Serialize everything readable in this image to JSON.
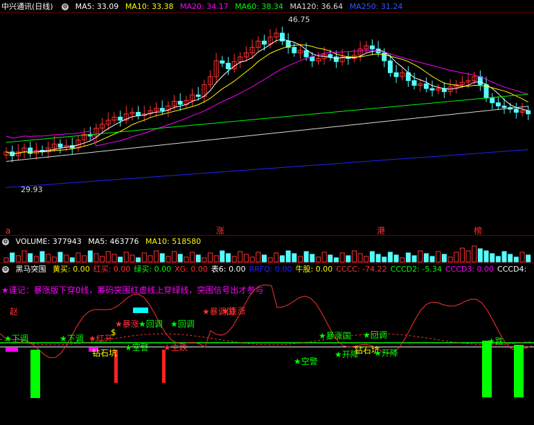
{
  "colors": {
    "up": "#ff3333",
    "down": "#54fcfc",
    "ma5": "#ffffff",
    "ma10": "#ffff00",
    "ma20": "#ff00ff",
    "ma60": "#00ff00",
    "ma120": "#dddddd",
    "ma250": "#2222ff",
    "bg": "#000000",
    "grid": "#7a0000"
  },
  "main": {
    "title": "中兴通讯(日线)",
    "ma5": "MA5: 33.09",
    "ma10": "MA10: 33.38",
    "ma20": "MA20: 34.17",
    "ma60": "MA60: 38.34",
    "ma120": "MA120: 36.64",
    "ma250": "MA250: 31.24",
    "high_label": "46.75",
    "low_label": "29.93",
    "markers": [
      "涨",
      "港",
      "榜"
    ],
    "marker_a": "a"
  },
  "volume": {
    "label": "VOLUME: 377943",
    "ma5": "MA5: 463776",
    "ma10": "MA10: 518580"
  },
  "indicator": {
    "name": "黑马突围",
    "fields": [
      {
        "text": "黄买: 0.00",
        "color": "#ffff00"
      },
      {
        "text": "红买: 0.00",
        "color": "#ff3333"
      },
      {
        "text": "绿买: 0.00",
        "color": "#00ff00"
      },
      {
        "text": "XG: 0.00",
        "color": "#ff3333"
      },
      {
        "text": "表6: 0.00",
        "color": "#ffffff"
      },
      {
        "text": "RRFQ: 0.00",
        "color": "#2222ff"
      },
      {
        "text": "牛股: 0.00",
        "color": "#ffff00"
      },
      {
        "text": "CCCC: -74.22",
        "color": "#ff3333"
      },
      {
        "text": "CCCD2: -5.34",
        "color": "#00ff00"
      },
      {
        "text": "CCCD3: 0.00",
        "color": "#ff00ff"
      },
      {
        "text": "CCCD4:",
        "color": "#ffffff"
      }
    ],
    "note": "★谨记：暴涨版下穿0线，筹码突围红虚线上穿绿线，突围信号出才参与",
    "signals": [
      {
        "text": "赵",
        "color": "#ff3333"
      },
      {
        "text": "★下调",
        "color": "#00ff00"
      },
      {
        "text": "★下调",
        "color": "#00ff00"
      },
      {
        "text": "★红开",
        "color": "#ff3333"
      },
      {
        "text": "钻石坑",
        "color": "#ffff00"
      },
      {
        "text": "★回调",
        "color": "#00ff00"
      },
      {
        "text": "★空警",
        "color": "#00ff00"
      },
      {
        "text": "★主跌",
        "color": "#ff3333"
      },
      {
        "text": "★暴涨",
        "color": "#ff3333"
      },
      {
        "text": "★回调",
        "color": "#00ff00"
      },
      {
        "text": "★暴调国",
        "color": "#ff3333"
      },
      {
        "text": "★连涨",
        "color": "#ff3333"
      },
      {
        "text": "★空警",
        "color": "#00ff00"
      },
      {
        "text": "★暴涨国",
        "color": "#00ff00"
      },
      {
        "text": "★开降",
        "color": "#00ff00"
      },
      {
        "text": "钻石坑",
        "color": "#ffff00"
      },
      {
        "text": "★回调",
        "color": "#00ff00"
      },
      {
        "text": "★开降",
        "color": "#00ff00"
      },
      {
        "text": "★跌",
        "color": "#00ff00"
      },
      {
        "text": "$",
        "color": "#ffff00"
      }
    ]
  }
}
